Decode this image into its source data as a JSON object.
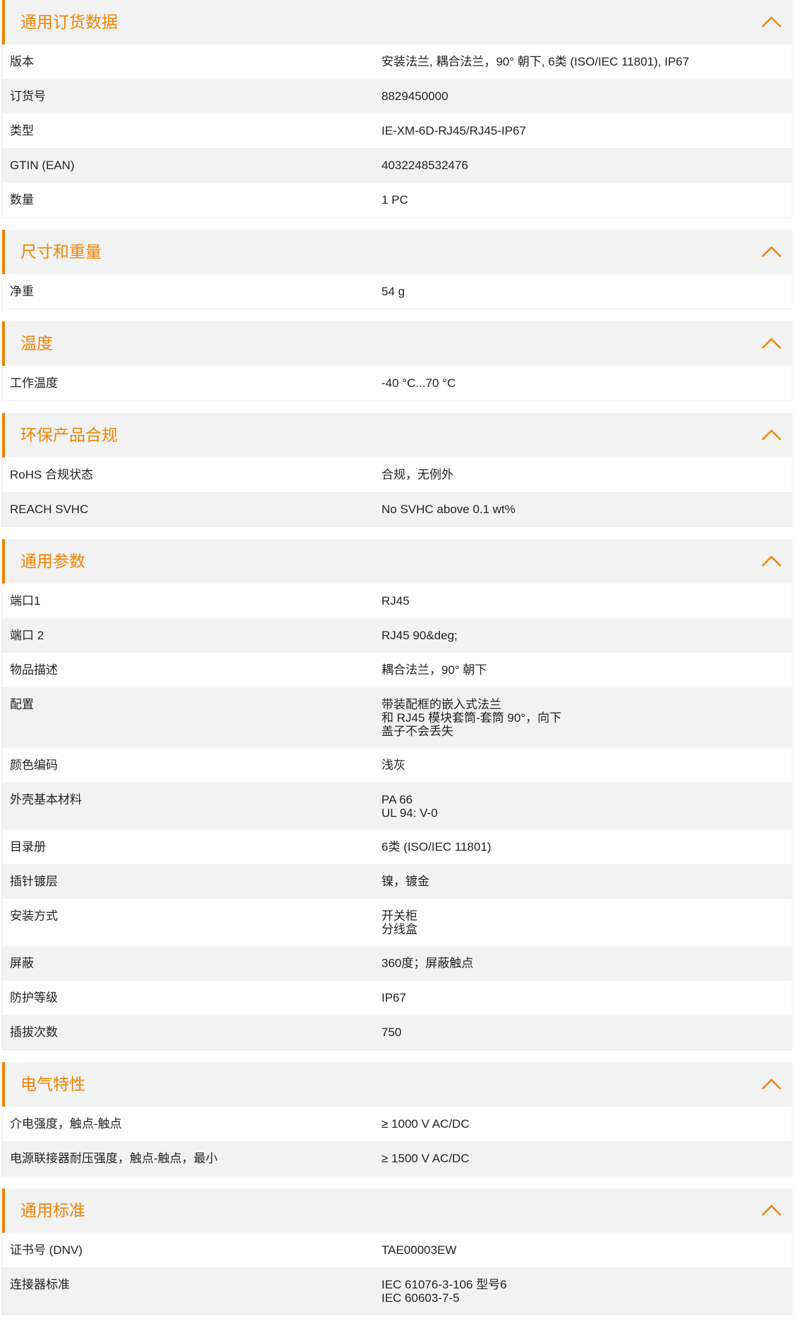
{
  "accent_color": "#f08300",
  "collapse_icon": "chevron-up-icon",
  "sections": [
    {
      "title": "通用订货数据",
      "rows": [
        {
          "label": "版本",
          "value": [
            "安装法兰, 耦合法兰，90° 朝下, 6类 (ISO/IEC 11801), IP67"
          ]
        },
        {
          "label": "订货号",
          "value": [
            "8829450000"
          ]
        },
        {
          "label": "类型",
          "value": [
            "IE-XM-6D-RJ45/RJ45-IP67"
          ]
        },
        {
          "label": "GTIN (EAN)",
          "value": [
            "4032248532476"
          ]
        },
        {
          "label": "数量",
          "value": [
            "1  PC"
          ]
        }
      ]
    },
    {
      "title": "尺寸和重量",
      "rows": [
        {
          "label": "净重",
          "value": [
            "54  g"
          ]
        }
      ]
    },
    {
      "title": "温度",
      "rows": [
        {
          "label": "工作温度",
          "value": [
            "-40 °C...70 °C"
          ]
        }
      ]
    },
    {
      "title": "环保产品合规",
      "rows": [
        {
          "label": "RoHS 合规状态",
          "value": [
            "合规，无例外"
          ]
        },
        {
          "label": "REACH SVHC",
          "value": [
            "No SVHC above 0.1 wt%"
          ]
        }
      ]
    },
    {
      "title": "通用参数",
      "rows": [
        {
          "label": "端口1",
          "value": [
            "RJ45"
          ]
        },
        {
          "label": "端口 2",
          "value": [
            "RJ45 90&deg;"
          ]
        },
        {
          "label": "物品描述",
          "value": [
            "耦合法兰，90° 朝下"
          ]
        },
        {
          "label": "配置",
          "value": [
            "带装配框的嵌入式法兰",
            "和 RJ45 模块套筒-套筒 90°，向下",
            "盖子不会丢失"
          ]
        },
        {
          "label": "颜色编码",
          "value": [
            "浅灰"
          ]
        },
        {
          "label": "外壳基本材料",
          "value": [
            "PA 66",
            "UL 94: V-0"
          ]
        },
        {
          "label": "目录册",
          "value": [
            "6类 (ISO/IEC 11801)"
          ]
        },
        {
          "label": "插针镀层",
          "value": [
            "镍，镀金"
          ]
        },
        {
          "label": "安装方式",
          "value": [
            "开关柜",
            "分线盒"
          ]
        },
        {
          "label": "屏蔽",
          "value": [
            "360度；屏蔽触点"
          ]
        },
        {
          "label": "防护等级",
          "value": [
            "IP67"
          ]
        },
        {
          "label": "插拔次数",
          "value": [
            "750"
          ]
        }
      ]
    },
    {
      "title": "电气特性",
      "rows": [
        {
          "label": "介电强度，触点-触点",
          "value": [
            "≥ 1000 V AC/DC"
          ]
        },
        {
          "label": "电源联接器耐压强度，触点-触点，最小",
          "value": [
            "≥ 1500 V AC/DC"
          ]
        }
      ]
    },
    {
      "title": "通用标准",
      "rows": [
        {
          "label": "证书号 (DNV)",
          "value": [
            "TAE00003EW"
          ]
        },
        {
          "label": "连接器标准",
          "value": [
            "IEC 61076-3-106 型号6",
            "IEC 60603-7-5"
          ]
        }
      ]
    }
  ]
}
